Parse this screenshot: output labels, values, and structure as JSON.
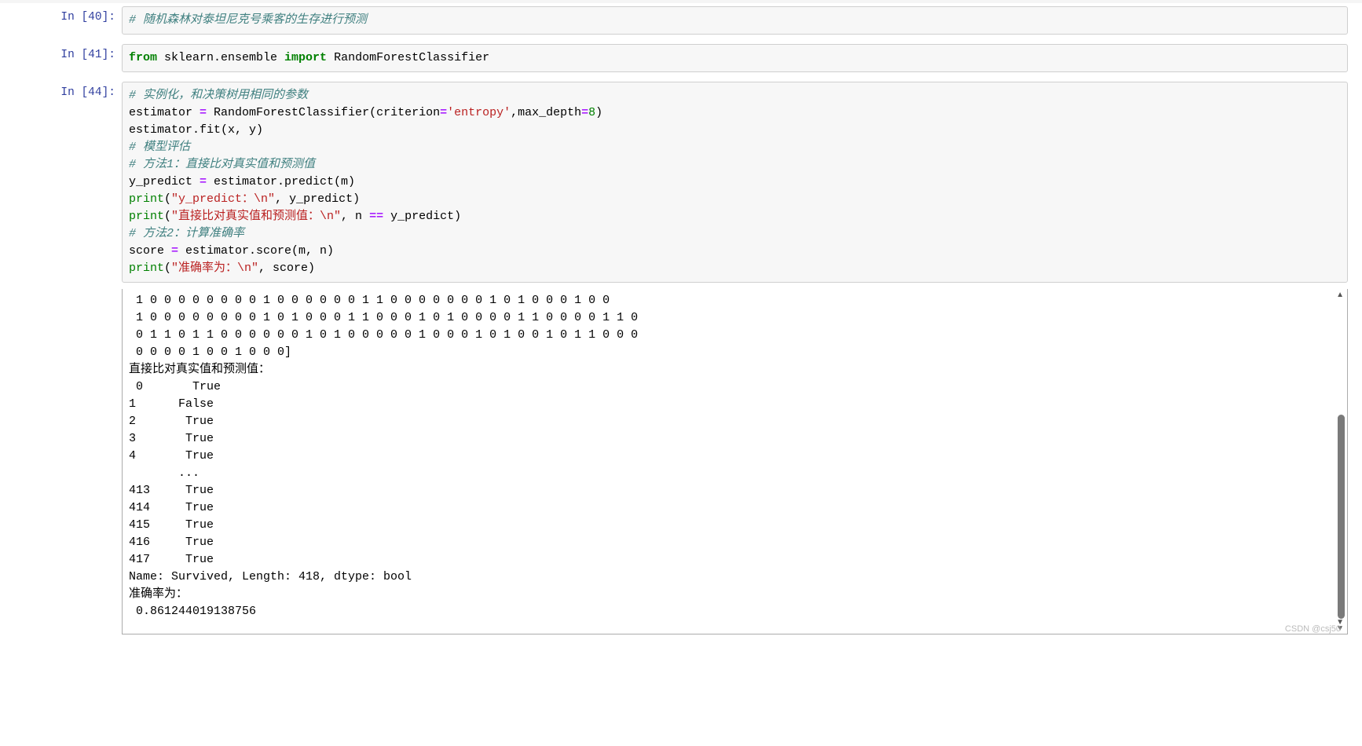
{
  "watermark": "CSDN @csj50",
  "cells": [
    {
      "prompt": "In [40]:",
      "code_html": "<span class=\"cm-comment\"># 随机森林对泰坦尼克号乘客的生存进行预测</span>"
    },
    {
      "prompt": "In [41]:",
      "code_html": "<span class=\"cm-keyword\">from</span> sklearn.ensemble <span class=\"cm-keyword\">import</span> RandomForestClassifier"
    },
    {
      "prompt": "In [44]:",
      "code_html": "<span class=\"cm-comment\"># 实例化，和决策树用相同的参数</span>\nestimator <span class=\"cm-operator\">=</span> RandomForestClassifier(criterion<span class=\"cm-operator\">=</span><span class=\"cm-string\">'entropy'</span>,max_depth<span class=\"cm-operator\">=</span><span class=\"cm-number\">8</span>)\nestimator.fit(x, y)\n<span class=\"cm-comment\"># 模型评估</span>\n<span class=\"cm-comment\"># 方法1：直接比对真实值和预测值</span>\ny_predict <span class=\"cm-operator\">=</span> estimator.predict(m)\n<span class=\"cm-builtin\">print</span>(<span class=\"cm-string\">\"y_predict：\\n\"</span>, y_predict)\n<span class=\"cm-builtin\">print</span>(<span class=\"cm-string\">\"直接比对真实值和预测值：\\n\"</span>, n <span class=\"cm-operator\">==</span> y_predict)\n<span class=\"cm-comment\"># 方法2：计算准确率</span>\nscore <span class=\"cm-operator\">=</span> estimator.score(m, n)\n<span class=\"cm-builtin\">print</span>(<span class=\"cm-string\">\"准确率为：\\n\"</span>, score)"
    }
  ],
  "output_text": " 1 0 0 0 0 0 0 0 0 1 0 0 0 0 0 0 1 1 0 0 0 0 0 0 0 1 0 1 0 0 0 1 0 0\n 1 0 0 0 0 0 0 0 0 1 0 1 0 0 0 1 1 0 0 0 1 0 1 0 0 0 0 1 1 0 0 0 0 1 1 0\n 0 1 1 0 1 1 0 0 0 0 0 0 1 0 1 0 0 0 0 0 1 0 0 0 1 0 1 0 0 1 0 1 1 0 0 0\n 0 0 0 0 1 0 0 1 0 0 0]\n直接比对真实值和预测值：\n 0       True\n1      False\n2       True\n3       True\n4       True\n       ...  \n413     True\n414     True\n415     True\n416     True\n417     True\nName: Survived, Length: 418, dtype: bool\n准确率为：\n 0.861244019138756"
}
